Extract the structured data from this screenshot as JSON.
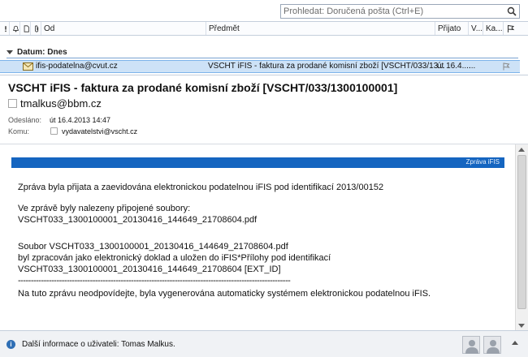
{
  "search": {
    "placeholder": "Prohledat: Doručená pošta (Ctrl+E)"
  },
  "columns": {
    "from": "Od",
    "subject": "Předmět",
    "received": "Přijato",
    "size": "V...",
    "category": "Ka..."
  },
  "group": {
    "label": "Datum: Dnes"
  },
  "message_row": {
    "from": "ifis-podatelna@cvut.cz",
    "subject": "VSCHT iFIS - faktura za prodané komisní zboží [VSCHT/033/13...",
    "date": "út 16.4....",
    "size": "..."
  },
  "reading": {
    "subject": "VSCHT iFIS - faktura za prodané komisní zboží   [VSCHT/033/1300100001]",
    "sender": "tmalkus@bbm.cz",
    "sent_label": "Odesláno:",
    "sent_value": "út 16.4.2013 14:47",
    "to_label": "Komu:",
    "to_value": "vydavatelstvi@vscht.cz",
    "banner": "Zpráva iFIS",
    "body": [
      "Zpráva byla přijata a zaevidována elektronickou podatelnou iFIS pod identifikací 2013/00152",
      "Ve zprávě byly nalezeny připojené soubory:",
      "VSCHT033_1300100001_20130416_144649_21708604.pdf",
      "Soubor VSCHT033_1300100001_20130416_144649_21708604.pdf",
      "byl zpracován jako elektronický doklad a uložen do iFIS*Přílohy pod identifikací",
      "VSCHT033_1300100001_20130416_144649_21708604 [EXT_ID]",
      "----------------------------------------------------------------------------------------------------------",
      "Na tuto zprávu neodpovídejte, byla vygenerována automaticky systémem elektronickou podatelnou iFIS."
    ]
  },
  "people_pane": {
    "text": "Další informace o uživateli: Tomas Malkus."
  },
  "colors": {
    "banner": "#1565c0",
    "selection": "#cde2f7"
  }
}
